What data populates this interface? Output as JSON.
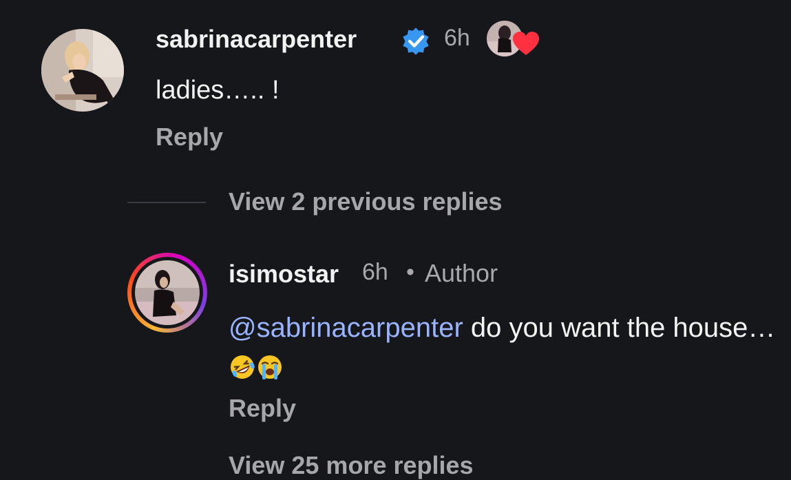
{
  "comments": [
    {
      "username": "sabrinacarpenter",
      "time": "6h",
      "text": "ladies….. !",
      "reply_label": "Reply",
      "verified": true,
      "liked_by_author": true
    }
  ],
  "view_replies_label": "View 2 previous replies",
  "reply": {
    "username": "isimostar",
    "time": "6h",
    "separator": "•",
    "author_badge": "Author",
    "mention": "@sabrinacarpenter",
    "text": " do you want the house…",
    "emojis": [
      "rolling-on-floor-laughing",
      "loudly-crying-face"
    ],
    "reply_label": "Reply"
  },
  "next_link_partial": "View 25 more replies",
  "colors": {
    "background": "#16171b",
    "mention": "#9ab3ff",
    "verified": "#3897f0",
    "heart": "#ff3040",
    "muted_text": "#a6a6ab"
  }
}
